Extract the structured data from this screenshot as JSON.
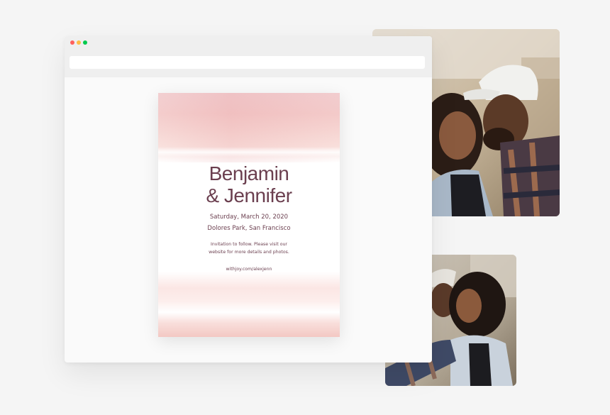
{
  "browser": {
    "window_controls": [
      {
        "name": "close",
        "color": "#ff605c"
      },
      {
        "name": "minimize",
        "color": "#ffbd44"
      },
      {
        "name": "maximize",
        "color": "#00ca4e"
      }
    ],
    "address_bar_value": ""
  },
  "invitation": {
    "name_line_1": "Benjamin",
    "name_line_2": "& Jennifer",
    "date": "Saturday, March 20, 2020",
    "venue": "Dolores Park, San Francisco",
    "message_line_1": "Invitation to follow. Please visit our",
    "message_line_2": "website for more details and photos.",
    "url": "withjoy.com/alexjenn",
    "accent_color": "#6b3f4f",
    "wash_color": "#f2c4c3"
  },
  "photos": [
    {
      "subject": "couple-kiss-photo"
    },
    {
      "subject": "couple-embrace-photo"
    }
  ]
}
